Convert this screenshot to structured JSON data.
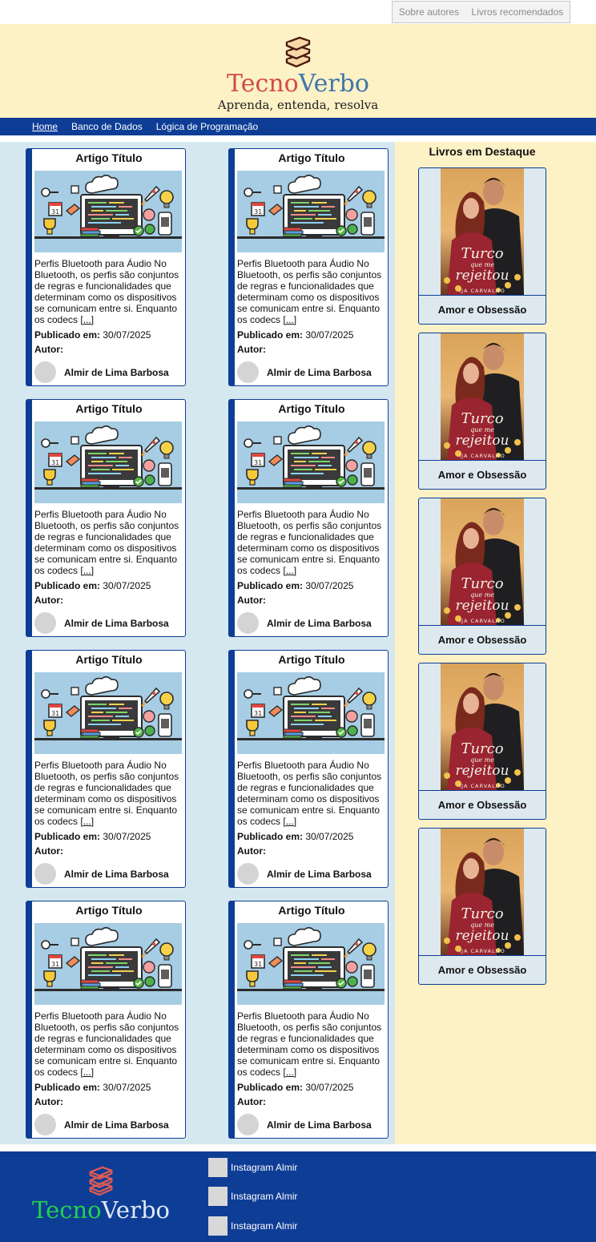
{
  "topbar": {
    "links": [
      "Sobre autores",
      "Livros recomendados"
    ]
  },
  "header": {
    "brand_part1": "Tecno",
    "brand_part2": "Verbo",
    "tagline": "Aprenda, entenda, resolva"
  },
  "nav": {
    "items": [
      "Home",
      "Banco de Dados",
      "Lógica de Programação"
    ],
    "active": "Home"
  },
  "articles": [
    {
      "title": "Artigo Título",
      "excerpt": "Perfis Bluetooth para Áudio No Bluetooth, os perfis são conjuntos de regras e funcionalidades que determinam como os dispositivos se comunicam entre si. Enquanto os codecs",
      "more": "[...]",
      "date_label": "Publicado em:",
      "date": "30/07/2025",
      "author_label": "Autor:",
      "author": "Almir de Lima Barbosa"
    },
    {
      "title": "Artigo Título",
      "excerpt": "Perfis Bluetooth para Áudio No Bluetooth, os perfis são conjuntos de regras e funcionalidades que determinam como os dispositivos se comunicam entre si. Enquanto os codecs",
      "more": "[...]",
      "date_label": "Publicado em:",
      "date": "30/07/2025",
      "author_label": "Autor:",
      "author": "Almir de Lima Barbosa"
    },
    {
      "title": "Artigo Título",
      "excerpt": "Perfis Bluetooth para Áudio No Bluetooth, os perfis são conjuntos de regras e funcionalidades que determinam como os dispositivos se comunicam entre si. Enquanto os codecs",
      "more": "[...]",
      "date_label": "Publicado em:",
      "date": "30/07/2025",
      "author_label": "Autor:",
      "author": "Almir de Lima Barbosa"
    },
    {
      "title": "Artigo Título",
      "excerpt": "Perfis Bluetooth para Áudio No Bluetooth, os perfis são conjuntos de regras e funcionalidades que determinam como os dispositivos se comunicam entre si. Enquanto os codecs",
      "more": "[...]",
      "date_label": "Publicado em:",
      "date": "30/07/2025",
      "author_label": "Autor:",
      "author": "Almir de Lima Barbosa"
    },
    {
      "title": "Artigo Título",
      "excerpt": "Perfis Bluetooth para Áudio No Bluetooth, os perfis são conjuntos de regras e funcionalidades que determinam como os dispositivos se comunicam entre si. Enquanto os codecs",
      "more": "[...]",
      "date_label": "Publicado em:",
      "date": "30/07/2025",
      "author_label": "Autor:",
      "author": "Almir de Lima Barbosa"
    },
    {
      "title": "Artigo Título",
      "excerpt": "Perfis Bluetooth para Áudio No Bluetooth, os perfis são conjuntos de regras e funcionalidades que determinam como os dispositivos se comunicam entre si. Enquanto os codecs",
      "more": "[...]",
      "date_label": "Publicado em:",
      "date": "30/07/2025",
      "author_label": "Autor:",
      "author": "Almir de Lima Barbosa"
    },
    {
      "title": "Artigo Título",
      "excerpt": "Perfis Bluetooth para Áudio No Bluetooth, os perfis são conjuntos de regras e funcionalidades que determinam como os dispositivos se comunicam entre si. Enquanto os codecs",
      "more": "[...]",
      "date_label": "Publicado em:",
      "date": "30/07/2025",
      "author_label": "Autor:",
      "author": "Almir de Lima Barbosa"
    },
    {
      "title": "Artigo Título",
      "excerpt": "Perfis Bluetooth para Áudio No Bluetooth, os perfis são conjuntos de regras e funcionalidades que determinam como os dispositivos se comunicam entre si. Enquanto os codecs",
      "more": "[...]",
      "date_label": "Publicado em:",
      "date": "30/07/2025",
      "author_label": "Autor:",
      "author": "Almir de Lima Barbosa"
    }
  ],
  "aside": {
    "title": "Livros em Destaque",
    "books": [
      "Amor e Obsessão",
      "Amor e Obsessão",
      "Amor e Obsessão",
      "Amor e Obsessão",
      "Amor e Obsessão"
    ],
    "cover_title": "Turco",
    "cover_line2": "que me",
    "cover_line3": "rejeitou",
    "cover_author": "IJA CARVALHO"
  },
  "footer": {
    "brand_part1": "Tecno",
    "brand_part2": "Verbo",
    "social": [
      "Instagram Almir",
      "Instagram Almir",
      "Instagram Almir"
    ]
  },
  "colors": {
    "navy": "#0e3d96",
    "cream": "#fdf1c6",
    "lightblue": "#d6e8ef",
    "brand_red": "#d34a46",
    "brand_blue": "#3f76a9",
    "footer_green": "#22d14c"
  }
}
